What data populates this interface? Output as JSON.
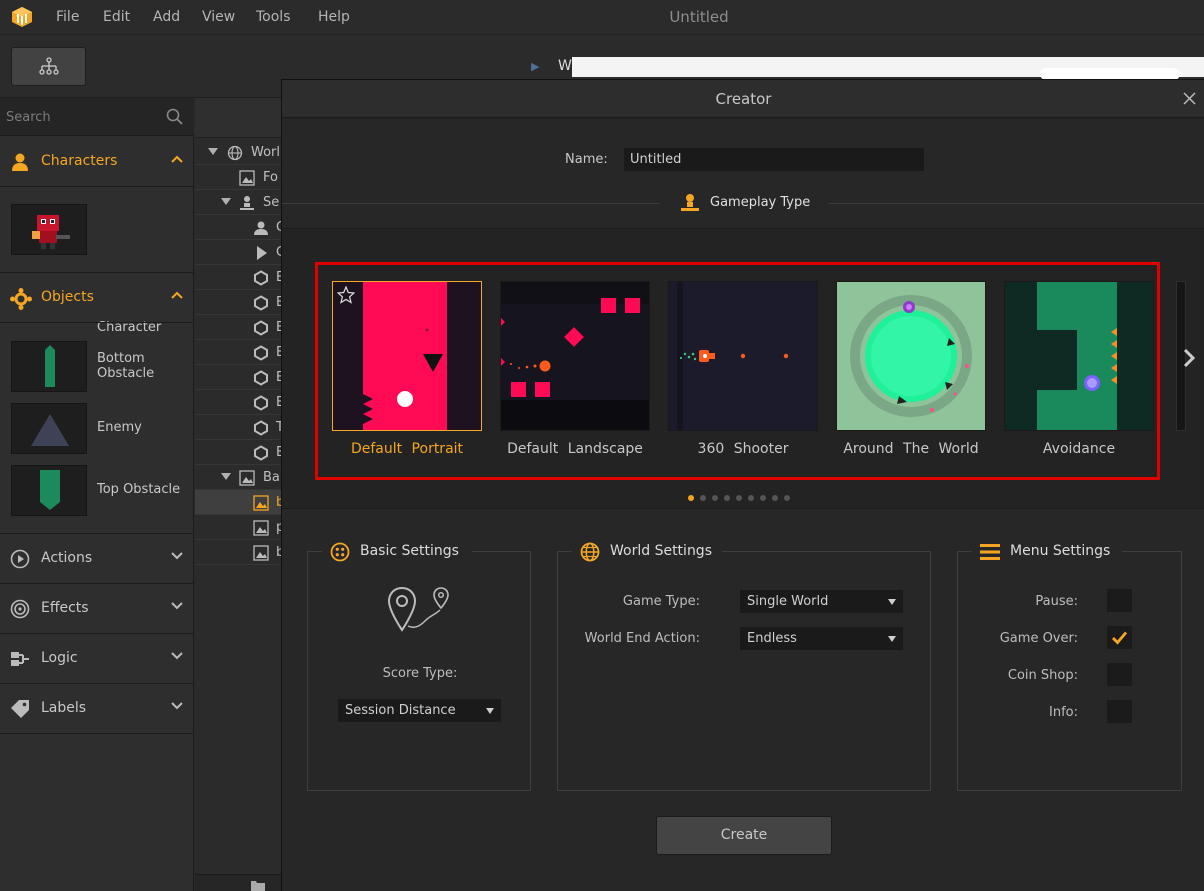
{
  "window": {
    "title": "Untitled"
  },
  "menu": [
    "File",
    "Edit",
    "Add",
    "View",
    "Tools",
    "Help"
  ],
  "toolbar": {
    "world_label": "W"
  },
  "left_panel": {
    "search_placeholder": "Search",
    "categories": {
      "characters": "Characters",
      "objects": "Objects",
      "actions": "Actions",
      "effects": "Effects",
      "logic": "Logic",
      "labels": "Labels"
    },
    "assets": {
      "character": "Character",
      "bottom_obstacle_1": "Bottom",
      "bottom_obstacle_2": "Obstacle",
      "enemy": "Enemy",
      "top_obstacle": "Top Obstacle"
    }
  },
  "tree": {
    "rows": [
      "Worl",
      "Fo",
      "Se",
      "C",
      "C",
      "E",
      "E",
      "E",
      "E",
      "E",
      "E",
      "T",
      "E",
      "Ba",
      "b",
      "p",
      "b"
    ]
  },
  "dialog": {
    "title": "Creator",
    "name_label": "Name:",
    "name_value": "Untitled",
    "gameplay_type_label": "Gameplay Type",
    "templates": [
      "Default  Portrait",
      "Default  Landscape",
      "360  Shooter",
      "Around  The  World",
      "Avoidance"
    ],
    "selected_template": 0,
    "page_count": 9,
    "current_page": 0,
    "basic_settings": {
      "title": "Basic Settings",
      "score_type_label": "Score Type:",
      "score_type_value": "Session Distance"
    },
    "world_settings": {
      "title": "World Settings",
      "game_type_label": "Game Type:",
      "game_type_value": "Single World",
      "world_end_action_label": "World End Action:",
      "world_end_action_value": "Endless"
    },
    "menu_settings": {
      "title": "Menu Settings",
      "pause_label": "Pause:",
      "pause_checked": false,
      "game_over_label": "Game Over:",
      "game_over_checked": true,
      "coin_shop_label": "Coin Shop:",
      "coin_shop_checked": false,
      "info_label": "Info:",
      "info_checked": false
    },
    "create_label": "Create"
  },
  "colors": {
    "accent": "#f5a623",
    "highlight_border": "#e00000",
    "template_pink": "#ff0a55"
  }
}
